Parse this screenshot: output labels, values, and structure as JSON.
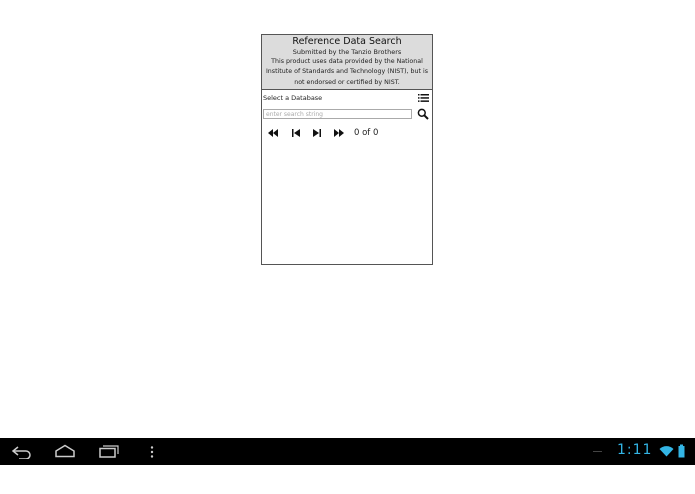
{
  "app": {
    "title": "Reference Data Search",
    "subtitle": "Submitted by the Tanzio Brothers",
    "notice": "This product uses data provided by the National Institute of Standards and Technology (NIST), but is not endorsed or certified by NIST."
  },
  "database": {
    "label": "Select a Database",
    "icon": "list-icon"
  },
  "search": {
    "placeholder": "enter search string",
    "value": "",
    "icon": "search-icon"
  },
  "navigation": {
    "first_icon": "rewind-icon",
    "prev_icon": "skip-previous-icon",
    "next_icon": "skip-next-icon",
    "last_icon": "fast-forward-icon",
    "counter": "0 of 0"
  },
  "system_bar": {
    "back_icon": "back-icon",
    "home_icon": "home-icon",
    "recents_icon": "recent-apps-icon",
    "menu_icon": "overflow-menu-icon",
    "time": "1:11",
    "wifi_icon": "wifi-icon",
    "battery_icon": "battery-icon",
    "accent_color": "#33b5e5"
  }
}
